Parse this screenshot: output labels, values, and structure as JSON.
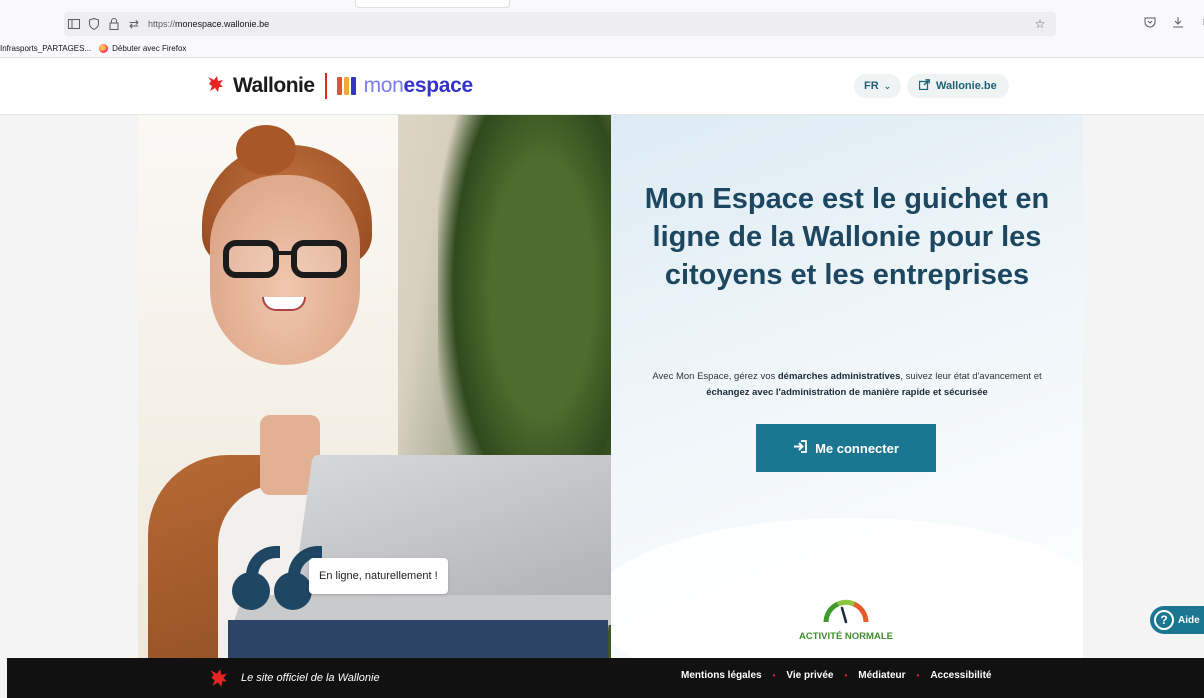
{
  "browser": {
    "url_prefix": "https://",
    "url_domain": "monespace.wallonie.be",
    "bookmarks": [
      {
        "label": "Infrasports_PARTAGES..."
      },
      {
        "label": "Débuter avec Firefox"
      }
    ]
  },
  "header": {
    "brand_wallonie": "Wallonie",
    "brand_mon": "mon",
    "brand_espace": "espace",
    "language": "FR",
    "external_link": "Wallonie.be"
  },
  "hero": {
    "quote": "En ligne, naturellement !",
    "title": "Mon Espace est le guichet en ligne de la Wallonie pour les citoyens et les entreprises",
    "subtitle_1": "Avec Mon Espace, gérez vos ",
    "subtitle_b1": "démarches administratives",
    "subtitle_2": ", suivez leur état d'avancement et ",
    "subtitle_b2": "échangez avec l'administration de manière rapide et sécurisée",
    "connect_button": "Me connecter",
    "status": "ACTIVITÉ NORMALE"
  },
  "help": {
    "label": "Aide"
  },
  "footer": {
    "tagline": "Le site officiel de la Wallonie",
    "links": [
      "Mentions légales",
      "Vie privée",
      "Médiateur",
      "Accessibilité"
    ]
  },
  "colors": {
    "accent": "#1b7791",
    "title": "#1d4760",
    "brand_red": "#e52521",
    "status_green": "#3f8f2c"
  }
}
